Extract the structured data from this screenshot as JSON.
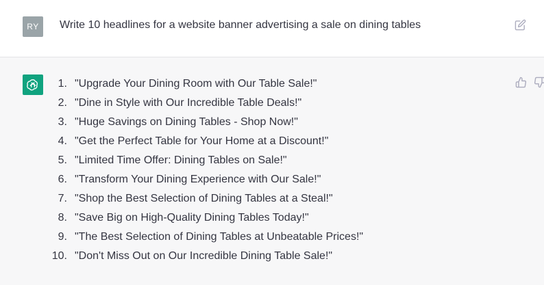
{
  "user_message": {
    "avatar_initials": "RY",
    "text": "Write 10 headlines for a website banner advertising a sale on dining tables",
    "edit_icon": "edit-icon"
  },
  "assistant_message": {
    "avatar_icon": "openai-logo-icon",
    "avatar_color": "#10a37f",
    "headlines": [
      {
        "num": "1.",
        "text": "\"Upgrade Your Dining Room with Our Table Sale!\""
      },
      {
        "num": "2.",
        "text": "\"Dine in Style with Our Incredible Table Deals!\""
      },
      {
        "num": "3.",
        "text": "\"Huge Savings on Dining Tables - Shop Now!\""
      },
      {
        "num": "4.",
        "text": "\"Get the Perfect Table for Your Home at a Discount!\""
      },
      {
        "num": "5.",
        "text": "\"Limited Time Offer: Dining Tables on Sale!\""
      },
      {
        "num": "6.",
        "text": "\"Transform Your Dining Experience with Our Sale!\""
      },
      {
        "num": "7.",
        "text": "\"Shop the Best Selection of Dining Tables at a Steal!\""
      },
      {
        "num": "8.",
        "text": "\"Save Big on High-Quality Dining Tables Today!\""
      },
      {
        "num": "9.",
        "text": "\"The Best Selection of Dining Tables at Unbeatable Prices!\""
      },
      {
        "num": "10.",
        "text": "\"Don't Miss Out on Our Incredible Dining Table Sale!\""
      }
    ],
    "feedback_icons": [
      "thumbs-up-icon",
      "thumbs-down-icon"
    ]
  }
}
